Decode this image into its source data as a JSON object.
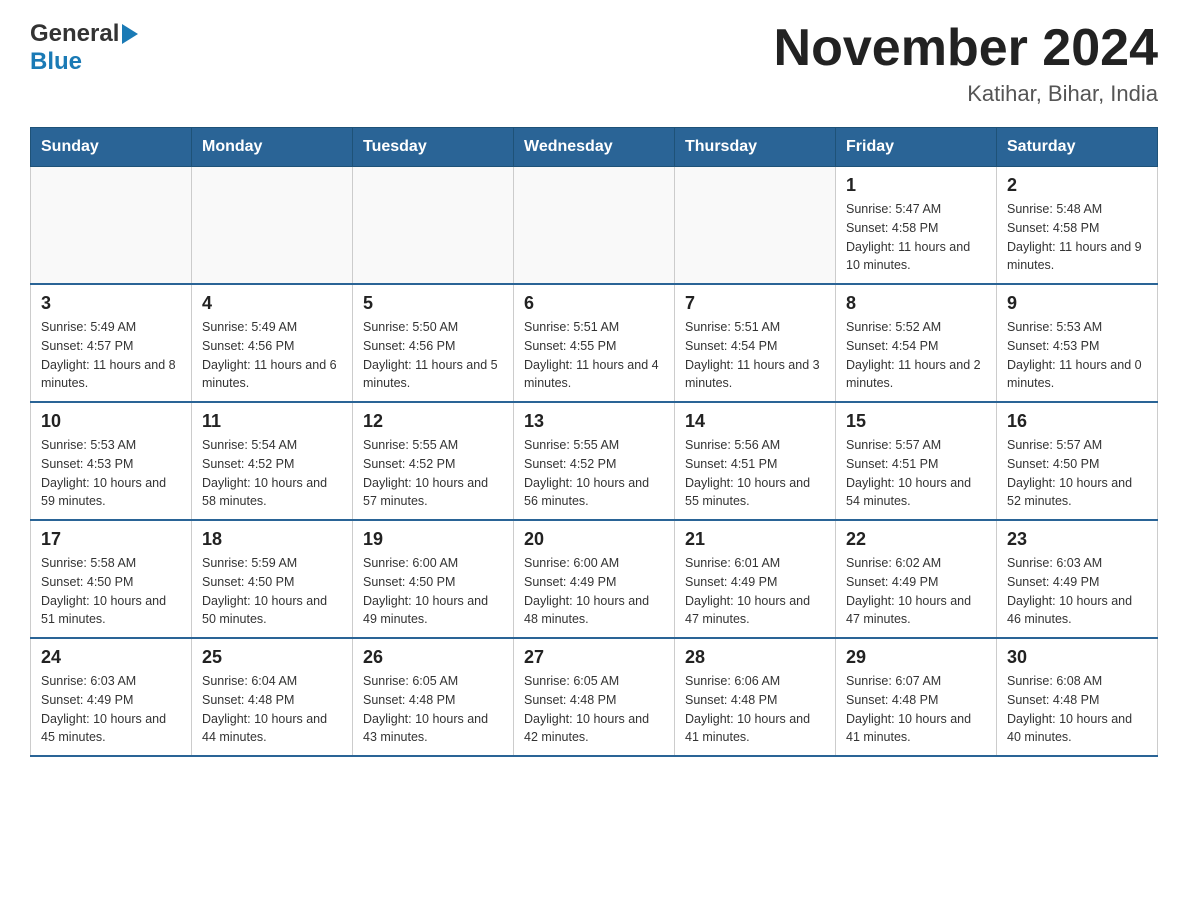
{
  "header": {
    "logo_general": "General",
    "logo_blue": "Blue",
    "month_title": "November 2024",
    "location": "Katihar, Bihar, India"
  },
  "days_of_week": [
    "Sunday",
    "Monday",
    "Tuesday",
    "Wednesday",
    "Thursday",
    "Friday",
    "Saturday"
  ],
  "weeks": [
    [
      {
        "day": "",
        "sunrise": "",
        "sunset": "",
        "daylight": ""
      },
      {
        "day": "",
        "sunrise": "",
        "sunset": "",
        "daylight": ""
      },
      {
        "day": "",
        "sunrise": "",
        "sunset": "",
        "daylight": ""
      },
      {
        "day": "",
        "sunrise": "",
        "sunset": "",
        "daylight": ""
      },
      {
        "day": "",
        "sunrise": "",
        "sunset": "",
        "daylight": ""
      },
      {
        "day": "1",
        "sunrise": "Sunrise: 5:47 AM",
        "sunset": "Sunset: 4:58 PM",
        "daylight": "Daylight: 11 hours and 10 minutes."
      },
      {
        "day": "2",
        "sunrise": "Sunrise: 5:48 AM",
        "sunset": "Sunset: 4:58 PM",
        "daylight": "Daylight: 11 hours and 9 minutes."
      }
    ],
    [
      {
        "day": "3",
        "sunrise": "Sunrise: 5:49 AM",
        "sunset": "Sunset: 4:57 PM",
        "daylight": "Daylight: 11 hours and 8 minutes."
      },
      {
        "day": "4",
        "sunrise": "Sunrise: 5:49 AM",
        "sunset": "Sunset: 4:56 PM",
        "daylight": "Daylight: 11 hours and 6 minutes."
      },
      {
        "day": "5",
        "sunrise": "Sunrise: 5:50 AM",
        "sunset": "Sunset: 4:56 PM",
        "daylight": "Daylight: 11 hours and 5 minutes."
      },
      {
        "day": "6",
        "sunrise": "Sunrise: 5:51 AM",
        "sunset": "Sunset: 4:55 PM",
        "daylight": "Daylight: 11 hours and 4 minutes."
      },
      {
        "day": "7",
        "sunrise": "Sunrise: 5:51 AM",
        "sunset": "Sunset: 4:54 PM",
        "daylight": "Daylight: 11 hours and 3 minutes."
      },
      {
        "day": "8",
        "sunrise": "Sunrise: 5:52 AM",
        "sunset": "Sunset: 4:54 PM",
        "daylight": "Daylight: 11 hours and 2 minutes."
      },
      {
        "day": "9",
        "sunrise": "Sunrise: 5:53 AM",
        "sunset": "Sunset: 4:53 PM",
        "daylight": "Daylight: 11 hours and 0 minutes."
      }
    ],
    [
      {
        "day": "10",
        "sunrise": "Sunrise: 5:53 AM",
        "sunset": "Sunset: 4:53 PM",
        "daylight": "Daylight: 10 hours and 59 minutes."
      },
      {
        "day": "11",
        "sunrise": "Sunrise: 5:54 AM",
        "sunset": "Sunset: 4:52 PM",
        "daylight": "Daylight: 10 hours and 58 minutes."
      },
      {
        "day": "12",
        "sunrise": "Sunrise: 5:55 AM",
        "sunset": "Sunset: 4:52 PM",
        "daylight": "Daylight: 10 hours and 57 minutes."
      },
      {
        "day": "13",
        "sunrise": "Sunrise: 5:55 AM",
        "sunset": "Sunset: 4:52 PM",
        "daylight": "Daylight: 10 hours and 56 minutes."
      },
      {
        "day": "14",
        "sunrise": "Sunrise: 5:56 AM",
        "sunset": "Sunset: 4:51 PM",
        "daylight": "Daylight: 10 hours and 55 minutes."
      },
      {
        "day": "15",
        "sunrise": "Sunrise: 5:57 AM",
        "sunset": "Sunset: 4:51 PM",
        "daylight": "Daylight: 10 hours and 54 minutes."
      },
      {
        "day": "16",
        "sunrise": "Sunrise: 5:57 AM",
        "sunset": "Sunset: 4:50 PM",
        "daylight": "Daylight: 10 hours and 52 minutes."
      }
    ],
    [
      {
        "day": "17",
        "sunrise": "Sunrise: 5:58 AM",
        "sunset": "Sunset: 4:50 PM",
        "daylight": "Daylight: 10 hours and 51 minutes."
      },
      {
        "day": "18",
        "sunrise": "Sunrise: 5:59 AM",
        "sunset": "Sunset: 4:50 PM",
        "daylight": "Daylight: 10 hours and 50 minutes."
      },
      {
        "day": "19",
        "sunrise": "Sunrise: 6:00 AM",
        "sunset": "Sunset: 4:50 PM",
        "daylight": "Daylight: 10 hours and 49 minutes."
      },
      {
        "day": "20",
        "sunrise": "Sunrise: 6:00 AM",
        "sunset": "Sunset: 4:49 PM",
        "daylight": "Daylight: 10 hours and 48 minutes."
      },
      {
        "day": "21",
        "sunrise": "Sunrise: 6:01 AM",
        "sunset": "Sunset: 4:49 PM",
        "daylight": "Daylight: 10 hours and 47 minutes."
      },
      {
        "day": "22",
        "sunrise": "Sunrise: 6:02 AM",
        "sunset": "Sunset: 4:49 PM",
        "daylight": "Daylight: 10 hours and 47 minutes."
      },
      {
        "day": "23",
        "sunrise": "Sunrise: 6:03 AM",
        "sunset": "Sunset: 4:49 PM",
        "daylight": "Daylight: 10 hours and 46 minutes."
      }
    ],
    [
      {
        "day": "24",
        "sunrise": "Sunrise: 6:03 AM",
        "sunset": "Sunset: 4:49 PM",
        "daylight": "Daylight: 10 hours and 45 minutes."
      },
      {
        "day": "25",
        "sunrise": "Sunrise: 6:04 AM",
        "sunset": "Sunset: 4:48 PM",
        "daylight": "Daylight: 10 hours and 44 minutes."
      },
      {
        "day": "26",
        "sunrise": "Sunrise: 6:05 AM",
        "sunset": "Sunset: 4:48 PM",
        "daylight": "Daylight: 10 hours and 43 minutes."
      },
      {
        "day": "27",
        "sunrise": "Sunrise: 6:05 AM",
        "sunset": "Sunset: 4:48 PM",
        "daylight": "Daylight: 10 hours and 42 minutes."
      },
      {
        "day": "28",
        "sunrise": "Sunrise: 6:06 AM",
        "sunset": "Sunset: 4:48 PM",
        "daylight": "Daylight: 10 hours and 41 minutes."
      },
      {
        "day": "29",
        "sunrise": "Sunrise: 6:07 AM",
        "sunset": "Sunset: 4:48 PM",
        "daylight": "Daylight: 10 hours and 41 minutes."
      },
      {
        "day": "30",
        "sunrise": "Sunrise: 6:08 AM",
        "sunset": "Sunset: 4:48 PM",
        "daylight": "Daylight: 10 hours and 40 minutes."
      }
    ]
  ]
}
